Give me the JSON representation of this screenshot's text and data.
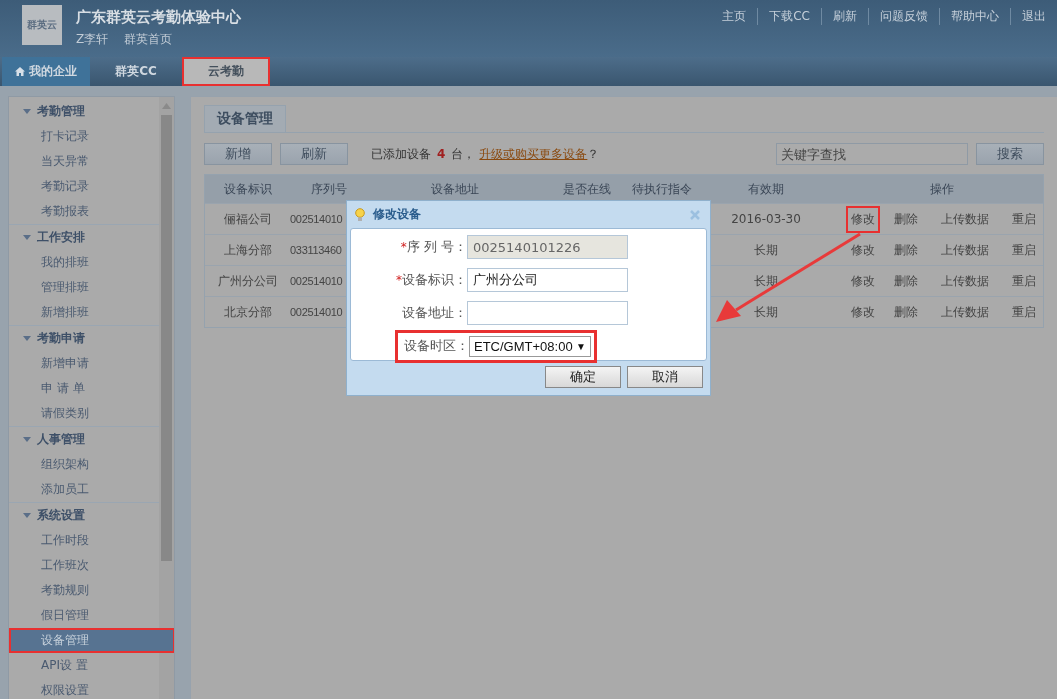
{
  "header": {
    "logo": "群英云",
    "title": "广东群英云考勤体验中心",
    "user": "Z李轩",
    "home_link": "群英首页",
    "links": [
      "主页",
      "下载CC",
      "刷新",
      "问题反馈",
      "帮助中心",
      "退出"
    ]
  },
  "nav_tabs": [
    {
      "kind": "home",
      "label": "我的企业",
      "selected": false,
      "highlighted": false
    },
    {
      "kind": "tab",
      "label": "群英CC",
      "selected": false,
      "highlighted": false
    },
    {
      "kind": "tab",
      "label": "云考勤",
      "selected": true,
      "highlighted": true
    }
  ],
  "sidebar": {
    "groups": [
      {
        "title": "考勤管理",
        "expanded": true,
        "items": [
          {
            "label": "打卡记录",
            "selected": false
          },
          {
            "label": "当天异常",
            "selected": false
          },
          {
            "label": "考勤记录",
            "selected": false
          },
          {
            "label": "考勤报表",
            "selected": false
          }
        ]
      },
      {
        "title": "工作安排",
        "expanded": true,
        "items": [
          {
            "label": "我的排班",
            "selected": false
          },
          {
            "label": "管理排班",
            "selected": false
          },
          {
            "label": "新增排班",
            "selected": false
          }
        ]
      },
      {
        "title": "考勤申请",
        "expanded": true,
        "items": [
          {
            "label": "新增申请",
            "selected": false
          },
          {
            "label": "申 请 单",
            "selected": false
          },
          {
            "label": "请假类别",
            "selected": false
          }
        ]
      },
      {
        "title": "人事管理",
        "expanded": true,
        "items": [
          {
            "label": "组织架构",
            "selected": false
          },
          {
            "label": "添加员工",
            "selected": false
          }
        ]
      },
      {
        "title": "系统设置",
        "expanded": true,
        "items": [
          {
            "label": "工作时段",
            "selected": false
          },
          {
            "label": "工作班次",
            "selected": false
          },
          {
            "label": "考勤规则",
            "selected": false
          },
          {
            "label": "假日管理",
            "selected": false
          },
          {
            "label": "设备管理",
            "selected": true
          },
          {
            "label": "API设 置",
            "selected": false
          },
          {
            "label": "权限设置",
            "selected": false
          }
        ]
      }
    ]
  },
  "panel": {
    "title": "设备管理",
    "buttons": [
      "新增",
      "刷新"
    ],
    "count_prefix": "已添加设备",
    "count": "4",
    "count_suffix": "台，",
    "upgrade_link": "升级或购买更多设备",
    "upgrade_end": "？",
    "search": {
      "placeholder": "关键字查找"
    },
    "search_button": "搜索"
  },
  "table": {
    "columns": [
      "设备标识",
      "序列号",
      "设备地址",
      "是否在线",
      "待执行指令",
      "有效期",
      "操作"
    ],
    "rows": [
      {
        "name": "俪福公司",
        "serial": "002514010",
        "expiry": "2016-03-30",
        "actions": [
          {
            "label": "修改",
            "highlighted": true
          },
          {
            "label": "删除",
            "highlighted": false
          },
          {
            "label": "上传数据",
            "highlighted": false
          },
          {
            "label": "重启",
            "highlighted": false
          }
        ]
      },
      {
        "name": "上海分部",
        "serial": "033113460",
        "expiry": "长期",
        "actions": [
          {
            "label": "修改",
            "highlighted": false
          },
          {
            "label": "删除",
            "highlighted": false
          },
          {
            "label": "上传数据",
            "highlighted": false
          },
          {
            "label": "重启",
            "highlighted": false
          }
        ]
      },
      {
        "name": "广州分公司",
        "serial": "002514010",
        "expiry": "长期",
        "actions": [
          {
            "label": "修改",
            "highlighted": false
          },
          {
            "label": "删除",
            "highlighted": false
          },
          {
            "label": "上传数据",
            "highlighted": false
          },
          {
            "label": "重启",
            "highlighted": false
          }
        ]
      },
      {
        "name": "北京分部",
        "serial": "002514010",
        "expiry": "长期",
        "actions": [
          {
            "label": "修改",
            "highlighted": false
          },
          {
            "label": "删除",
            "highlighted": false
          },
          {
            "label": "上传数据",
            "highlighted": false
          },
          {
            "label": "重启",
            "highlighted": false
          }
        ]
      }
    ]
  },
  "dialog": {
    "title": "修改设备",
    "fields": [
      {
        "kind": "input",
        "label": "序 列 号：",
        "required_mark": "*",
        "value": "0025140101226",
        "disabled": true,
        "highlighted": false
      },
      {
        "kind": "input",
        "label": "设备标识：",
        "required_mark": "*",
        "value": "广州分公司",
        "disabled": false,
        "highlighted": false
      },
      {
        "kind": "input",
        "label": "设备地址：",
        "disabled": false,
        "highlighted": false
      },
      {
        "kind": "select",
        "label": "设备时区：",
        "value": "ETC/GMT+08:00",
        "arrow": "▼",
        "disabled": false,
        "highlighted": true
      }
    ],
    "buttons": [
      "确定",
      "取消"
    ]
  }
}
